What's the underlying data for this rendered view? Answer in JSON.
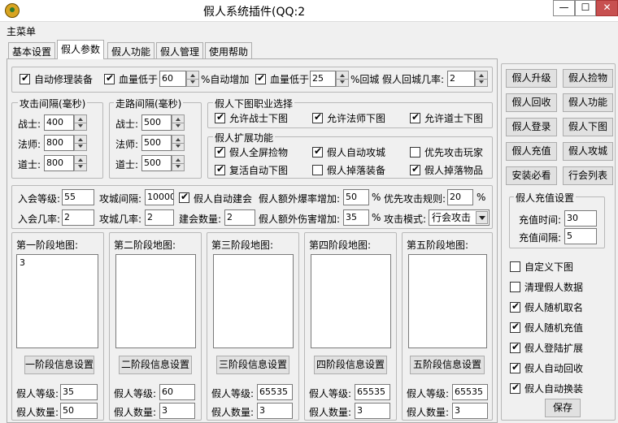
{
  "window": {
    "title": "假人系统插件(QQ:2",
    "min_glyph": "—",
    "max_glyph": "☐",
    "close_glyph": "✕"
  },
  "menu": {
    "main": "主菜单"
  },
  "tabs": [
    "基本设置",
    "假人参数",
    "假人功能",
    "假人管理",
    "使用帮助"
  ],
  "top_row": {
    "auto_repair": "自动修理装备",
    "hp_low1": "血量低于",
    "hp_low1_value": "60",
    "auto_increase": "%自动增加",
    "hp_low2": "血量低于",
    "hp_low2_value": "25",
    "return_city": "%回城",
    "return_rate_label": "假人回城几率:",
    "return_rate_value": "2"
  },
  "attack_interval": {
    "title": "攻击间隔(毫秒)",
    "warrior": "战士:",
    "warrior_value": "400",
    "mage": "法师:",
    "mage_value": "800",
    "taoist": "道士:",
    "taoist_value": "800"
  },
  "walk_interval": {
    "title": "走路间隔(毫秒)",
    "warrior": "战士:",
    "warrior_value": "500",
    "mage": "法师:",
    "mage_value": "500",
    "taoist": "道士:",
    "taoist_value": "500"
  },
  "map_jobs": {
    "title": "假人下图职业选择",
    "warrior": "允许战士下图",
    "mage": "允许法师下图",
    "taoist": "允许道士下图"
  },
  "extensions": {
    "title": "假人扩展功能",
    "fullscreen_pickup": "假人全屏捡物",
    "auto_siege": "假人自动攻城",
    "prioritize_players": "优先攻击玩家",
    "revive_map": "复活自动下图",
    "drop_equip": "假人掉落装备",
    "drop_items": "假人掉落物品"
  },
  "params": {
    "join_level": "入会等级:",
    "join_level_value": "55",
    "siege_interval": "攻城间隔:",
    "siege_interval_value": "10000",
    "auto_guild": "假人自动建会",
    "extra_drop": "假人额外爆率增加:",
    "extra_drop_value": "50",
    "percent": "%",
    "priority_rule": "优先攻击规则:",
    "priority_rule_value": "20",
    "join_rate": "入会几率:",
    "join_rate_value": "2",
    "siege_rate": "攻城几率:",
    "siege_rate_value": "2",
    "guild_count": "建会数量:",
    "guild_count_value": "2",
    "extra_damage": "假人额外伤害增加:",
    "extra_damage_value": "35",
    "attack_mode": "攻击模式:",
    "attack_mode_value": "行会攻击"
  },
  "stages": [
    {
      "title": "第一阶段地图:",
      "maps": "3",
      "button": "一阶段信息设置",
      "level_label": "假人等级:",
      "level": "35",
      "count_label": "假人数量:",
      "count": "50"
    },
    {
      "title": "第二阶段地图:",
      "maps": "",
      "button": "二阶段信息设置",
      "level_label": "假人等级:",
      "level": "60",
      "count_label": "假人数量:",
      "count": "3"
    },
    {
      "title": "第三阶段地图:",
      "maps": "",
      "button": "三阶段信息设置",
      "level_label": "假人等级:",
      "level": "65535",
      "count_label": "假人数量:",
      "count": "3"
    },
    {
      "title": "第四阶段地图:",
      "maps": "",
      "button": "四阶段信息设置",
      "level_label": "假人等级:",
      "level": "65535",
      "count_label": "假人数量:",
      "count": "3"
    },
    {
      "title": "第五阶段地图:",
      "maps": "",
      "button": "五阶段信息设置",
      "level_label": "假人等级:",
      "level": "65535",
      "count_label": "假人数量:",
      "count": "3"
    }
  ],
  "right_panel": {
    "buttons": [
      "假人升级",
      "假人捡物",
      "假人回收",
      "假人功能",
      "假人登录",
      "假人下图",
      "假人充值",
      "假人攻城",
      "安装必看",
      "行会列表"
    ],
    "recharge": {
      "title": "假人充值设置",
      "time_label": "充值时间:",
      "time_value": "30",
      "interval_label": "充值间隔:",
      "interval_value": "5"
    },
    "options": [
      "自定义下图",
      "清理假人数据",
      "假人随机取名",
      "假人随机充值",
      "假人登陆扩展",
      "假人自动回收",
      "假人自动换装"
    ],
    "save": "保存"
  }
}
